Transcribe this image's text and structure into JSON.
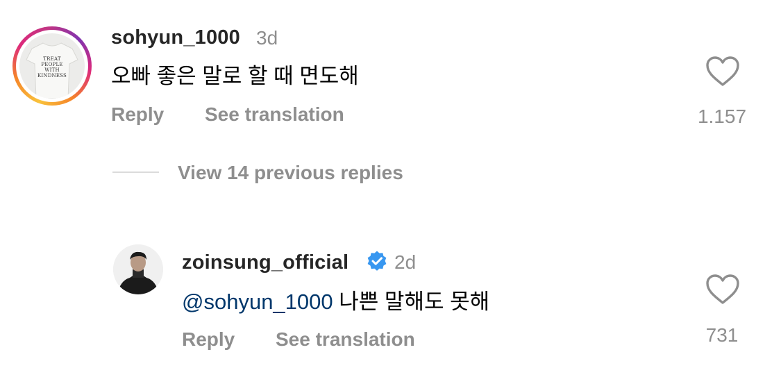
{
  "comment1": {
    "username": "sohyun_1000",
    "time": "3d",
    "text": "오빠 좋은 말로 할 때 면도해",
    "reply_label": "Reply",
    "translate_label": "See translation",
    "likes": "1.157",
    "avatar_text": "TREAT PEOPLE WITH KINDNESS",
    "avatar_lines": [
      "TREAT",
      "PEOPLE",
      "WITH",
      "KINDNESS"
    ]
  },
  "thread": {
    "view_replies_label": "View 14 previous replies"
  },
  "comment2": {
    "username": "zoinsung_official",
    "time": "2d",
    "mention": "@sohyun_1000",
    "text": "나쁜 말해도 못해",
    "reply_label": "Reply",
    "translate_label": "See translation",
    "likes": "731",
    "verified": true
  },
  "icons": {
    "like": "heart-icon",
    "verified": "verified-badge-icon"
  },
  "colors": {
    "username": "#262626",
    "secondary": "#8e8e8e",
    "mention": "#00376b",
    "verified": "#3897f0"
  }
}
